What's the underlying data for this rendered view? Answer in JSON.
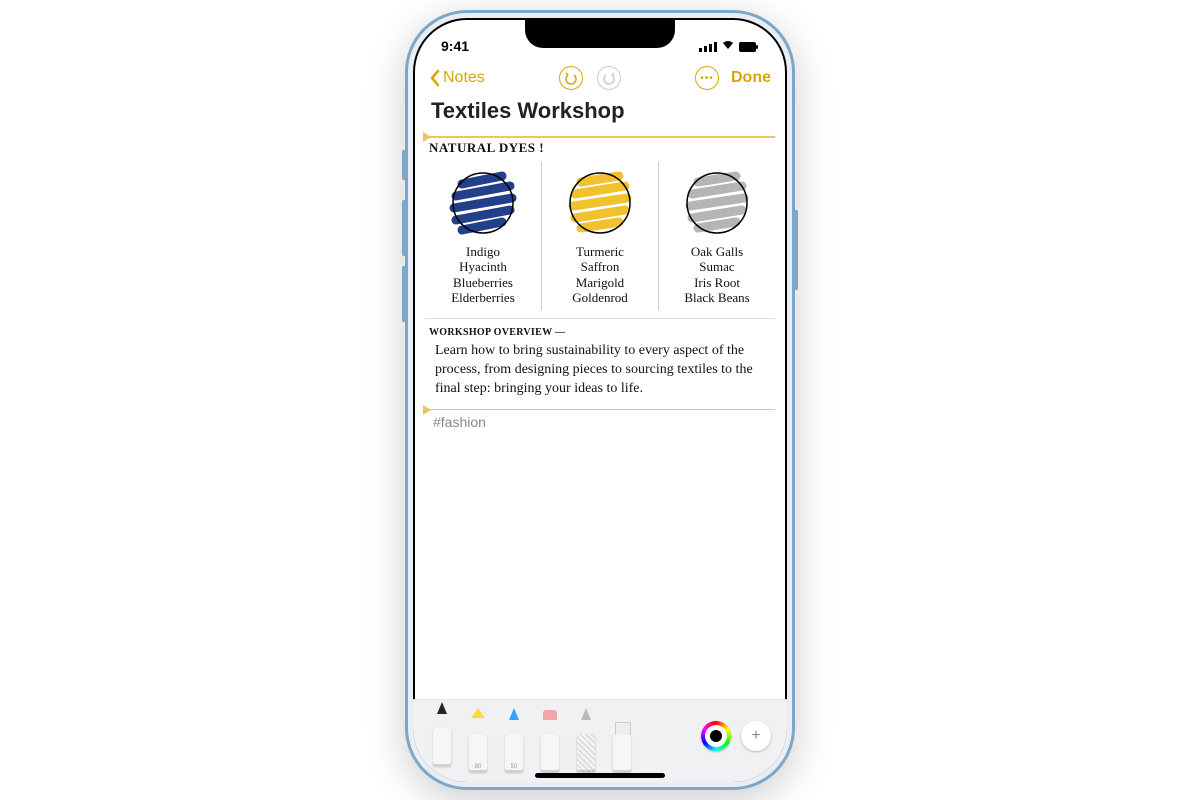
{
  "status": {
    "time": "9:41"
  },
  "nav": {
    "back_label": "Notes",
    "done_label": "Done"
  },
  "note": {
    "title": "Textiles Workshop",
    "section_heading": "NATURAL DYES !",
    "swatches": [
      {
        "color": "#243f8a",
        "sources": [
          "Indigo",
          "Hyacinth",
          "Blueberries",
          "Elderberries"
        ]
      },
      {
        "color": "#f2c12e",
        "sources": [
          "Turmeric",
          "Saffron",
          "Marigold",
          "Goldenrod"
        ]
      },
      {
        "color": "#a9a9a9",
        "sources": [
          "Oak Galls",
          "Sumac",
          "Iris Root",
          "Black Beans"
        ]
      }
    ],
    "overview_heading": "WORKSHOP OVERVIEW —",
    "overview_body": "Learn how to bring sustainability to every aspect of the process, from designing pieces to sourcing textiles to the final step: bringing your ideas to life.",
    "hashtag": "#fashion"
  },
  "tools": {
    "items": [
      {
        "name": "pen",
        "selected": true
      },
      {
        "name": "highlighter",
        "label": "80"
      },
      {
        "name": "pencil",
        "label": "50"
      },
      {
        "name": "eraser"
      },
      {
        "name": "lasso"
      },
      {
        "name": "ruler"
      }
    ]
  },
  "colors": {
    "accent_gold": "#d4a800"
  }
}
